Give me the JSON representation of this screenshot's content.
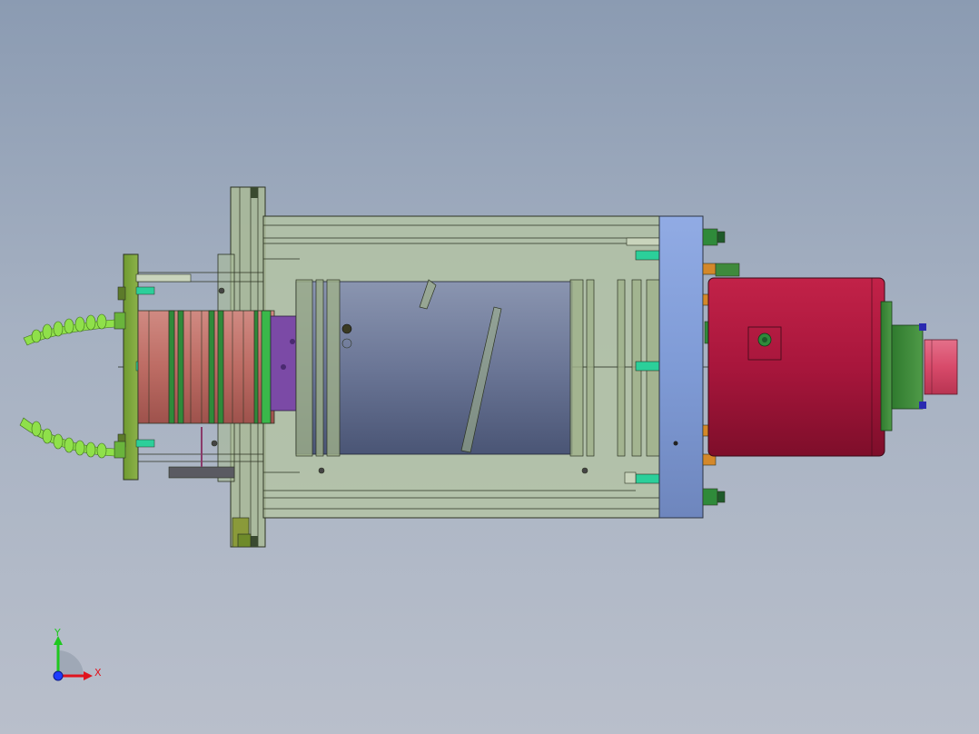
{
  "scene": {
    "background_top": "#8b9bb2",
    "background_bottom": "#b9bfcb",
    "model_description_visible": false
  },
  "triad": {
    "x_label": "X",
    "y_label": "Y",
    "x_color": "#e0141e",
    "y_color": "#1fc81f",
    "z_color": "#1e3cff"
  },
  "colors": {
    "housing": "#b3c3a0",
    "left_flange": "#7aa43a",
    "stator_rings": "#c0726a",
    "purple_ring": "#7b4aa6",
    "rotor": "#6b7898",
    "blue_flange": "#7f9bd6",
    "red_nose": "#b0183f",
    "green_flange": "#3f8a3c",
    "pink_tip": "#d84a6a",
    "hoses": "#8fe04a",
    "fittings": "#2bcf9a",
    "bolts": "#d4882a"
  },
  "icons": {
    "triad": "coordinate-triad-icon"
  }
}
